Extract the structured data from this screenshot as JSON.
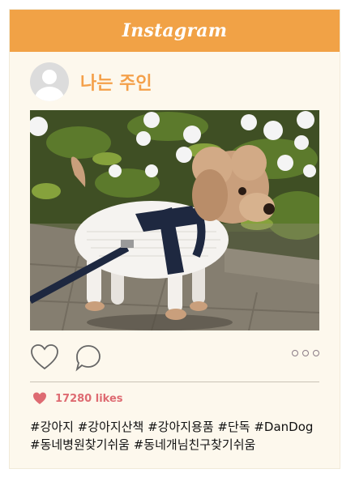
{
  "header": {
    "brand": "Instagram"
  },
  "profile": {
    "username": "나는 주인"
  },
  "post": {
    "likes": "17280 likes",
    "hashtags_line1": "#강아지 #강아지산책 #강아지용품 #단독 #DanDog",
    "hashtags_line2": "#동네병원찾기쉬움 #동네개님친구찾기쉬움"
  },
  "icons": {
    "like": "heart-icon",
    "comment": "comment-bubble-icon",
    "more": "more-options-icon",
    "likes_indicator": "filled-heart-icon"
  },
  "colors": {
    "header_bg": "#f1a246",
    "username": "#f4a04a",
    "likes": "#de6b72",
    "card_bg": "#fdf8ed"
  }
}
